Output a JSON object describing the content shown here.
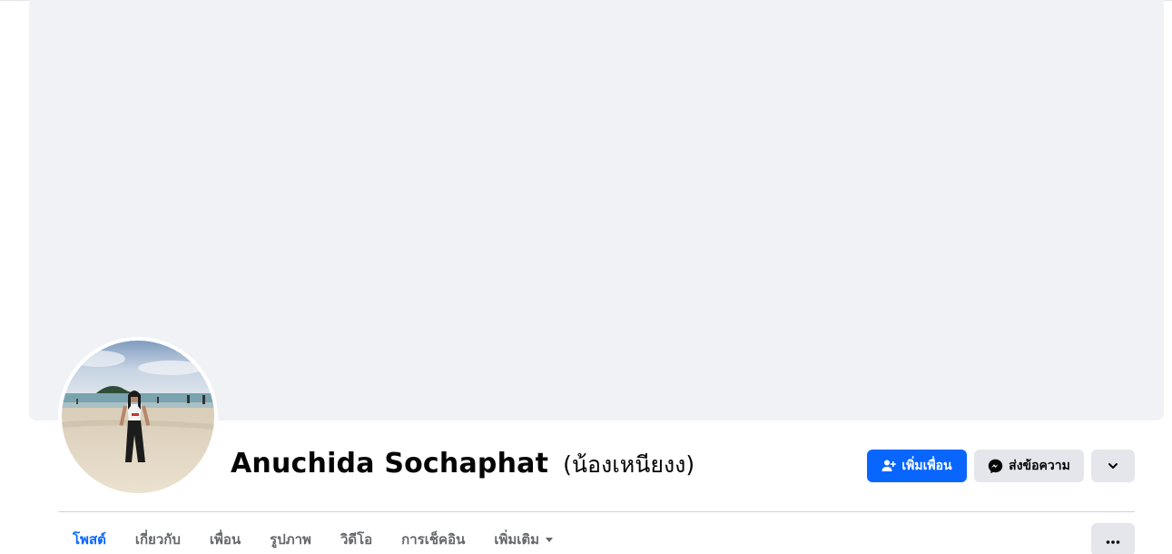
{
  "profile": {
    "name": "Anuchida Sochaphat",
    "alternate_name": "(น้องเหนียงง)"
  },
  "actions": {
    "add_friend_label": "เพิ่มเพื่อน",
    "add_friend_icon": "person-add-icon",
    "message_label": "ส่งข้อความ",
    "message_icon": "messenger-icon",
    "more_icon": "chevron-down-icon"
  },
  "tabs": [
    {
      "label": "โพสต์",
      "active": true
    },
    {
      "label": "เกี่ยวกับ",
      "active": false
    },
    {
      "label": "เพื่อน",
      "active": false
    },
    {
      "label": "รูปภาพ",
      "active": false
    },
    {
      "label": "วิดีโอ",
      "active": false
    },
    {
      "label": "การเช็คอิน",
      "active": false
    },
    {
      "label": "เพิ่มเติม",
      "active": false
    }
  ],
  "tab_overflow_icon": "ellipsis-icon",
  "colors": {
    "accent": "#0866ff",
    "cover_bg": "#f0f2f5",
    "secondary_button": "#e4e6eb",
    "text_primary": "#050505",
    "text_secondary": "#65676b"
  }
}
